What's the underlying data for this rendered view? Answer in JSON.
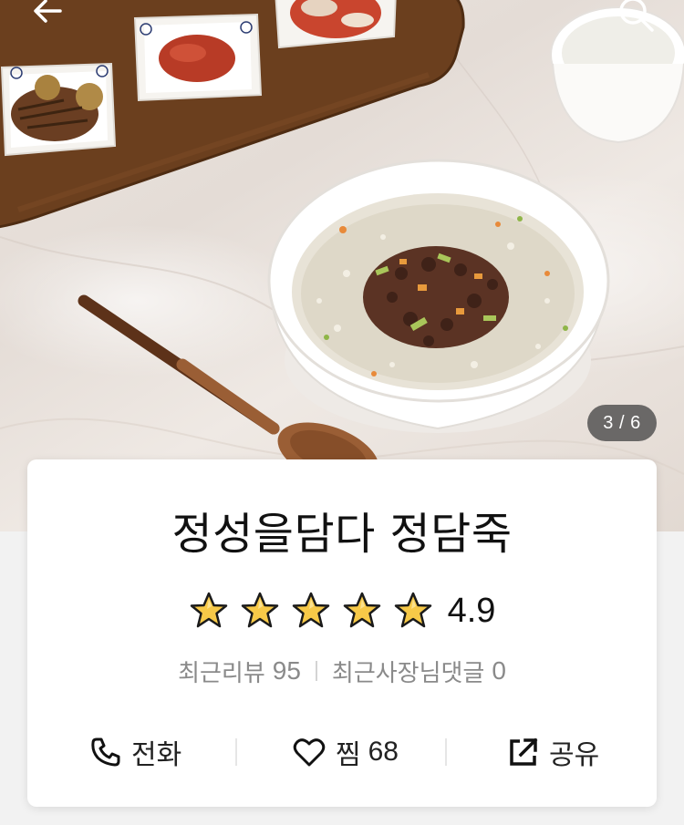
{
  "hero": {
    "photo_description_icon": "porridge-photo",
    "counter": "3 / 6",
    "back_icon": "arrow-left-icon",
    "search_icon": "search-icon"
  },
  "store": {
    "name": "정성을담다 정담죽",
    "rating": "4.9",
    "rating_stars": 5
  },
  "stats": {
    "reviews_label": "최근리뷰",
    "reviews_count": "95",
    "owner_replies_label": "최근사장님댓글",
    "owner_replies_count": "0"
  },
  "actions": {
    "call_label": "전화",
    "like_label": "찜",
    "like_count": "68",
    "share_label": "공유"
  },
  "colors": {
    "star_fill": "#f7c948",
    "text_primary": "#111111",
    "text_secondary": "#8a8a8a",
    "counter_bg": "#464646"
  }
}
